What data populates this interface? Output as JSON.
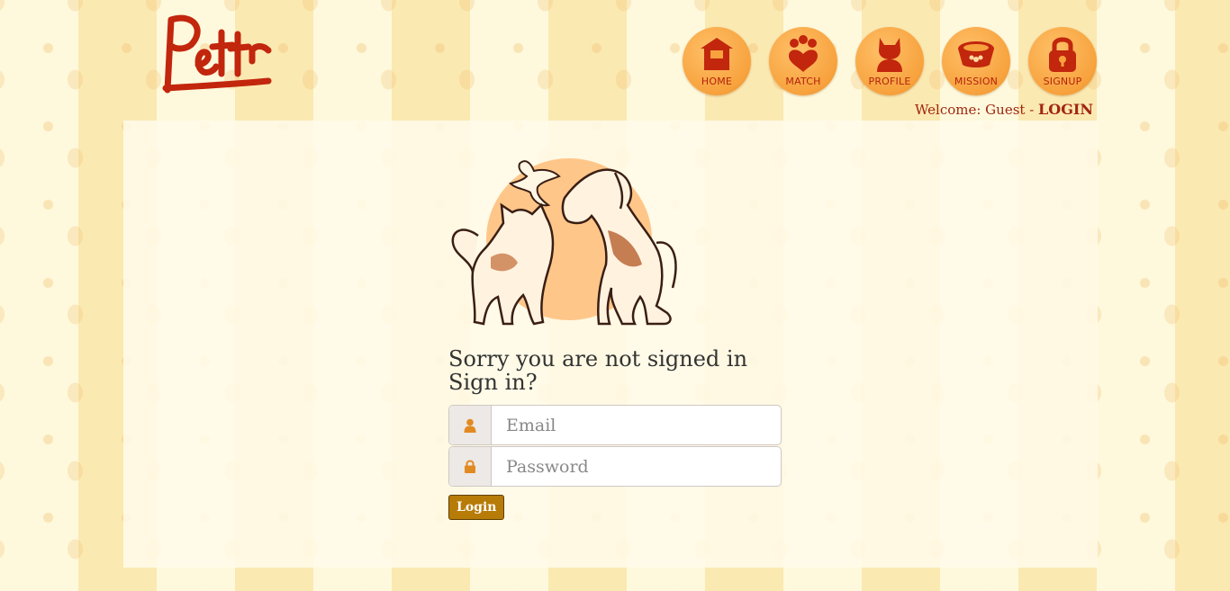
{
  "brand": {
    "logo_text": "Pettr"
  },
  "nav": {
    "items": [
      {
        "label": "HOME",
        "icon": "house-icon"
      },
      {
        "label": "MATCH",
        "icon": "paw-heart-icon"
      },
      {
        "label": "PROFILE",
        "icon": "cat-profile-icon"
      },
      {
        "label": "MISSION",
        "icon": "pet-bowl-icon"
      },
      {
        "label": "SIGNUP",
        "icon": "padlock-icon"
      }
    ]
  },
  "header": {
    "welcome_text": "Welcome: Guest",
    "separator": " - ",
    "login_link": "LOGIN"
  },
  "main": {
    "line1": "Sorry you are not signed in",
    "line2": "Sign in?",
    "email": {
      "placeholder": "Email",
      "value": ""
    },
    "password": {
      "placeholder": "Password",
      "value": ""
    },
    "submit_label": "Login"
  },
  "colors": {
    "accent": "#b77b07",
    "nav_orange": "#f7a23d",
    "brand_red": "#b3230c",
    "stripe_light": "#fef9dc",
    "stripe_dark": "#fbe9b2"
  }
}
